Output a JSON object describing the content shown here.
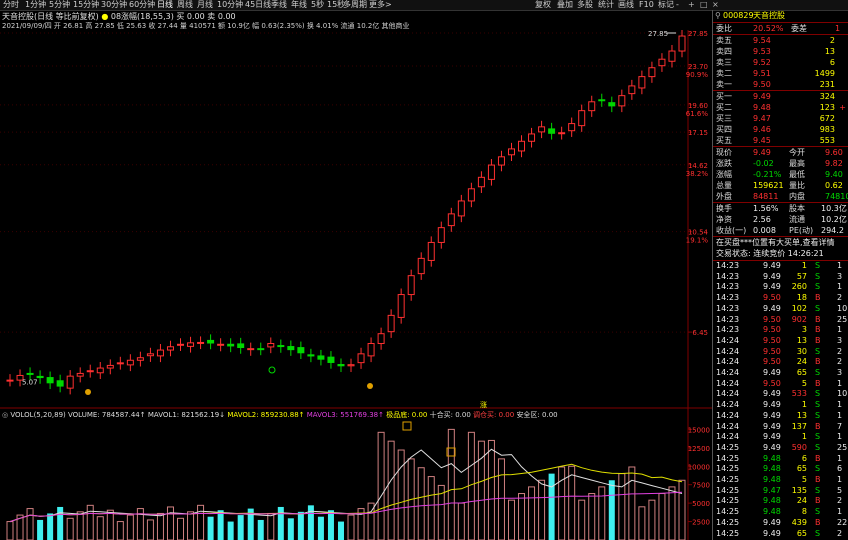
{
  "toolbar": {
    "timeframes": [
      "分时",
      "1分钟",
      "5分钟",
      "15分钟",
      "30分钟",
      "60分钟",
      "日线",
      "周线",
      "月线",
      "10分钟",
      "45日线",
      "季线",
      "年线",
      "5秒",
      "15秒",
      "多周期",
      "更多>"
    ],
    "right_buttons": [
      "复权",
      "叠加",
      "多股",
      "统计",
      "画线",
      "F10",
      "标记",
      "-"
    ],
    "window_controls": [
      "+",
      "□",
      "×"
    ]
  },
  "chart_info": {
    "line1_name": "天音控股(日线 等比前复权)",
    "line1_rest": "08涨幅(18,55,3)  买 0.00  卖 0.00",
    "line2": "2021/09/09/四 开 26.81 高 27.85 低 25.63 收 27.44 量 410571 额 10.9亿 幅 0.63(2.35%) 换 4.01% 流通 10.2亿 其他商业"
  },
  "price_axis": {
    "labels": [
      "27.85",
      "23.70",
      "19.60",
      "17.15",
      "14.62",
      "10.54",
      "6.45"
    ],
    "pct_labels": [
      "",
      "90.9%",
      "61.6%",
      "",
      "38.2%",
      "19.1%",
      ""
    ]
  },
  "annotations": {
    "peak_label": "27.85",
    "low_label": "5.07",
    "bottom_marker": "涨"
  },
  "volume_info": {
    "name": "VOLOL(5,20,89)",
    "volume": "VOLUME: 784587.44↑",
    "mavol1": "MAVOL1: 821562.19↓",
    "mavol2": "MAVOL2: 859230.88↑",
    "mavol3": "MAVOL3: 551769.38↑",
    "extra1": "极品底: 0.00",
    "extra2": "十合买: 0.00",
    "extra3": "调仓买: 0.00",
    "extra4": "安全区: 0.00"
  },
  "volume_axis": {
    "labels": [
      "15000",
      "12500",
      "10000",
      "7500",
      "5000",
      "2500"
    ]
  },
  "stock": {
    "code": "000829",
    "name": "天音控股"
  },
  "order_book": {
    "weibi_label": "委比",
    "weibi_value": "20.52%",
    "weicha_label": "委差",
    "weicha_value": "1",
    "asks": [
      {
        "label": "卖五",
        "price": "9.54",
        "vol": "2"
      },
      {
        "label": "卖四",
        "price": "9.53",
        "vol": "13"
      },
      {
        "label": "卖三",
        "price": "9.52",
        "vol": "6"
      },
      {
        "label": "卖二",
        "price": "9.51",
        "vol": "1499"
      },
      {
        "label": "卖一",
        "price": "9.50",
        "vol": "231"
      }
    ],
    "bids": [
      {
        "label": "买一",
        "price": "9.49",
        "vol": "324"
      },
      {
        "label": "买二",
        "price": "9.48",
        "vol": "123"
      },
      {
        "label": "买三",
        "price": "9.47",
        "vol": "672"
      },
      {
        "label": "买四",
        "price": "9.46",
        "vol": "983"
      },
      {
        "label": "买五",
        "price": "9.45",
        "vol": "553"
      }
    ],
    "bid2_flag": "+"
  },
  "quote": {
    "rows": [
      {
        "l1": "现价",
        "v1": "9.49",
        "l2": "今开",
        "v2": "9.60"
      },
      {
        "l1": "涨跌",
        "v1": "-0.02",
        "l2": "最高",
        "v2": "9.82"
      },
      {
        "l1": "涨幅",
        "v1": "-0.21%",
        "l2": "最低",
        "v2": "9.40"
      },
      {
        "l1": "总量",
        "v1": "159621",
        "l2": "量比",
        "v2": "0.62"
      },
      {
        "l1": "外盘",
        "v1": "84811",
        "l2": "内盘",
        "v2": "74810"
      }
    ],
    "rows2": [
      {
        "l1": "换手",
        "v1": "1.56%",
        "l2": "股本",
        "v2": "10.3亿"
      },
      {
        "l1": "净资",
        "v1": "2.56",
        "l2": "流通",
        "v2": "10.2亿"
      },
      {
        "l1": "收益(一)",
        "v1": "0.008",
        "l2": "PE(动)",
        "v2": "294.2"
      }
    ],
    "notice": "在买盘***位置有大买单,查看详情",
    "status": "交易状态: 连续竞价 14:26:21"
  },
  "ticks": [
    {
      "t": "14:23",
      "p": "9.49",
      "v": "1",
      "f": "S",
      "n": "1"
    },
    {
      "t": "14:23",
      "p": "9.49",
      "v": "57",
      "f": "S",
      "n": "3"
    },
    {
      "t": "14:23",
      "p": "9.49",
      "v": "260",
      "f": "S",
      "n": "1"
    },
    {
      "t": "14:23",
      "p": "9.50",
      "v": "18",
      "f": "B",
      "n": "2"
    },
    {
      "t": "14:23",
      "p": "9.49",
      "v": "102",
      "f": "S",
      "n": "10"
    },
    {
      "t": "14:23",
      "p": "9.50",
      "v": "902",
      "f": "B",
      "n": "25"
    },
    {
      "t": "14:23",
      "p": "9.50",
      "v": "3",
      "f": "B",
      "n": "1"
    },
    {
      "t": "14:24",
      "p": "9.50",
      "v": "13",
      "f": "B",
      "n": "3"
    },
    {
      "t": "14:24",
      "p": "9.50",
      "v": "30",
      "f": "S",
      "n": "2"
    },
    {
      "t": "14:24",
      "p": "9.50",
      "v": "24",
      "f": "B",
      "n": "2"
    },
    {
      "t": "14:24",
      "p": "9.49",
      "v": "65",
      "f": "S",
      "n": "3"
    },
    {
      "t": "14:24",
      "p": "9.50",
      "v": "5",
      "f": "B",
      "n": "1"
    },
    {
      "t": "14:24",
      "p": "9.49",
      "v": "533",
      "f": "S",
      "n": "10"
    },
    {
      "t": "14:24",
      "p": "9.49",
      "v": "1",
      "f": "S",
      "n": "1"
    },
    {
      "t": "14:24",
      "p": "9.49",
      "v": "13",
      "f": "S",
      "n": "1"
    },
    {
      "t": "14:24",
      "p": "9.49",
      "v": "137",
      "f": "B",
      "n": "7"
    },
    {
      "t": "14:24",
      "p": "9.49",
      "v": "1",
      "f": "S",
      "n": "1"
    },
    {
      "t": "14:25",
      "p": "9.49",
      "v": "590",
      "f": "S",
      "n": "25"
    },
    {
      "t": "14:25",
      "p": "9.48",
      "v": "6",
      "f": "B",
      "n": "1"
    },
    {
      "t": "14:25",
      "p": "9.48",
      "v": "65",
      "f": "S",
      "n": "6"
    },
    {
      "t": "14:25",
      "p": "9.48",
      "v": "5",
      "f": "B",
      "n": "1"
    },
    {
      "t": "14:25",
      "p": "9.47",
      "v": "135",
      "f": "S",
      "n": "5"
    },
    {
      "t": "14:25",
      "p": "9.48",
      "v": "24",
      "f": "B",
      "n": "2"
    },
    {
      "t": "14:25",
      "p": "9.48",
      "v": "8",
      "f": "S",
      "n": "1"
    },
    {
      "t": "14:25",
      "p": "9.49",
      "v": "439",
      "f": "B",
      "n": "22"
    },
    {
      "t": "14:25",
      "p": "9.49",
      "v": "65",
      "f": "S",
      "n": "2"
    }
  ],
  "colors": {
    "up": "#ff3030",
    "down": "#00d800",
    "volume_up": "#d08080",
    "volume_down": "#40f0f0",
    "text_yellow": "#ffff00"
  }
}
